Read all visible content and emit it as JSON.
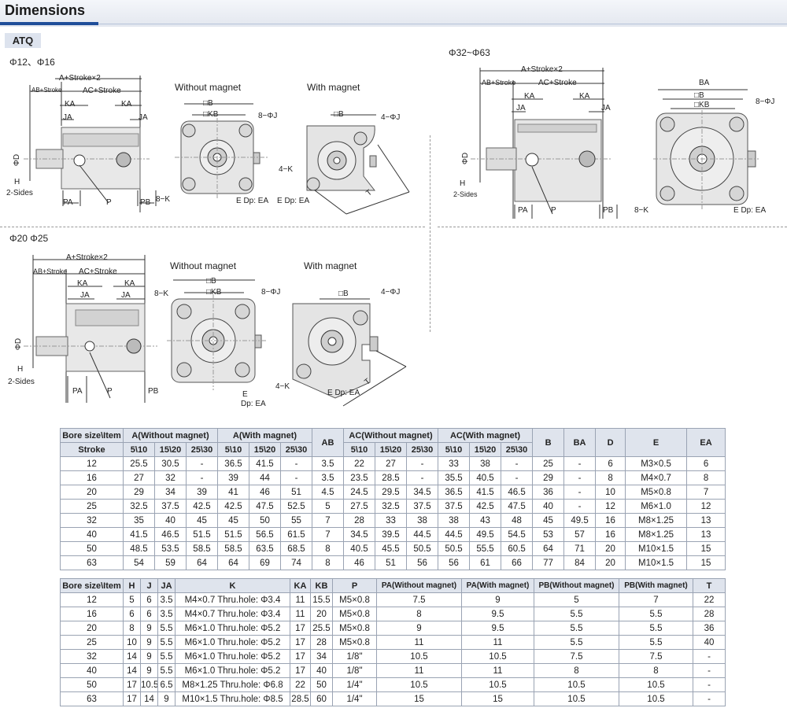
{
  "header": {
    "title": "Dimensions",
    "series": "ATQ"
  },
  "sections": {
    "top_left": {
      "bore_label": "Φ12、Φ16",
      "view1": "Without magnet",
      "view2": "With magnet"
    },
    "top_right": {
      "bore_label": "Φ32~Φ63"
    },
    "bottom_left": {
      "bore_label": "Φ20  Φ25",
      "view1": "Without magnet",
      "view2": "With magnet"
    }
  },
  "dim_labels": {
    "a_stroke2": "A+Stroke×2",
    "ab_stroke": "AB+Stroke",
    "ac_stroke": "AC+Stroke",
    "ka": "KA",
    "ja": "JA",
    "phi_d": "ΦD",
    "h": "H",
    "two_sides": "2-Sides",
    "pa": "PA",
    "p": "P",
    "pb": "PB",
    "b": "□B",
    "kb": "□KB",
    "ba": "BA",
    "eight_phi_j": "8−ΦJ",
    "four_phi_j": "4−ΦJ",
    "eight_k": "8−K",
    "four_k": "4−K",
    "e_dp_ea": "E Dp: EA",
    "e": "E",
    "dp_ea": "Dp:  EA",
    "t": "T"
  },
  "table1": {
    "header_row1": [
      "Bore size\\Item",
      "A(Without magnet)",
      "A(With magnet)",
      "AB",
      "AC(Without magnet)",
      "AC(With magnet)",
      "B",
      "BA",
      "D",
      "E",
      "EA"
    ],
    "header_row2": [
      "Stroke",
      "5\\10",
      "15\\20",
      "25\\30",
      "5\\10",
      "15\\20",
      "25\\30",
      "5\\10",
      "15\\20",
      "25\\30",
      "5\\10",
      "15\\20",
      "25\\30"
    ],
    "rows": [
      [
        "12",
        "25.5",
        "30.5",
        "-",
        "36.5",
        "41.5",
        "-",
        "3.5",
        "22",
        "27",
        "-",
        "33",
        "38",
        "-",
        "25",
        "-",
        "6",
        "M3×0.5",
        "6"
      ],
      [
        "16",
        "27",
        "32",
        "-",
        "39",
        "44",
        "-",
        "3.5",
        "23.5",
        "28.5",
        "-",
        "35.5",
        "40.5",
        "-",
        "29",
        "-",
        "8",
        "M4×0.7",
        "8"
      ],
      [
        "20",
        "29",
        "34",
        "39",
        "41",
        "46",
        "51",
        "4.5",
        "24.5",
        "29.5",
        "34.5",
        "36.5",
        "41.5",
        "46.5",
        "36",
        "-",
        "10",
        "M5×0.8",
        "7"
      ],
      [
        "25",
        "32.5",
        "37.5",
        "42.5",
        "42.5",
        "47.5",
        "52.5",
        "5",
        "27.5",
        "32.5",
        "37.5",
        "37.5",
        "42.5",
        "47.5",
        "40",
        "-",
        "12",
        "M6×1.0",
        "12"
      ],
      [
        "32",
        "35",
        "40",
        "45",
        "45",
        "50",
        "55",
        "7",
        "28",
        "33",
        "38",
        "38",
        "43",
        "48",
        "45",
        "49.5",
        "16",
        "M8×1.25",
        "13"
      ],
      [
        "40",
        "41.5",
        "46.5",
        "51.5",
        "51.5",
        "56.5",
        "61.5",
        "7",
        "34.5",
        "39.5",
        "44.5",
        "44.5",
        "49.5",
        "54.5",
        "53",
        "57",
        "16",
        "M8×1.25",
        "13"
      ],
      [
        "50",
        "48.5",
        "53.5",
        "58.5",
        "58.5",
        "63.5",
        "68.5",
        "8",
        "40.5",
        "45.5",
        "50.5",
        "50.5",
        "55.5",
        "60.5",
        "64",
        "71",
        "20",
        "M10×1.5",
        "15"
      ],
      [
        "63",
        "54",
        "59",
        "64",
        "64",
        "69",
        "74",
        "8",
        "46",
        "51",
        "56",
        "56",
        "61",
        "66",
        "77",
        "84",
        "20",
        "M10×1.5",
        "15"
      ]
    ]
  },
  "table2": {
    "header": [
      "Bore size\\Item",
      "H",
      "J",
      "JA",
      "K",
      "KA",
      "KB",
      "P",
      "PA(Without magnet)",
      "PA(With magnet)",
      "PB(Without magnet)",
      "PB(With magnet)",
      "T"
    ],
    "rows": [
      [
        "12",
        "5",
        "6",
        "3.5",
        "M4×0.7 Thru.hole: Φ3.4",
        "11",
        "15.5",
        "M5×0.8",
        "7.5",
        "9",
        "5",
        "7",
        "22"
      ],
      [
        "16",
        "6",
        "6",
        "3.5",
        "M4×0.7 Thru.hole: Φ3.4",
        "11",
        "20",
        "M5×0.8",
        "8",
        "9.5",
        "5.5",
        "5.5",
        "28"
      ],
      [
        "20",
        "8",
        "9",
        "5.5",
        "M6×1.0 Thru.hole: Φ5.2",
        "17",
        "25.5",
        "M5×0.8",
        "9",
        "9.5",
        "5.5",
        "5.5",
        "36"
      ],
      [
        "25",
        "10",
        "9",
        "5.5",
        "M6×1.0 Thru.hole: Φ5.2",
        "17",
        "28",
        "M5×0.8",
        "11",
        "11",
        "5.5",
        "5.5",
        "40"
      ],
      [
        "32",
        "14",
        "9",
        "5.5",
        "M6×1.0 Thru.hole: Φ5.2",
        "17",
        "34",
        "1/8\"",
        "10.5",
        "10.5",
        "7.5",
        "7.5",
        "-"
      ],
      [
        "40",
        "14",
        "9",
        "5.5",
        "M6×1.0 Thru.hole: Φ5.2",
        "17",
        "40",
        "1/8\"",
        "11",
        "11",
        "8",
        "8",
        "-"
      ],
      [
        "50",
        "17",
        "10.5",
        "6.5",
        "M8×1.25 Thru.hole: Φ6.8",
        "22",
        "50",
        "1/4\"",
        "10.5",
        "10.5",
        "10.5",
        "10.5",
        "-"
      ],
      [
        "63",
        "17",
        "14",
        "9",
        "M10×1.5 Thru.hole: Φ8.5",
        "28.5",
        "60",
        "1/4\"",
        "15",
        "15",
        "10.5",
        "10.5",
        "-"
      ]
    ]
  }
}
